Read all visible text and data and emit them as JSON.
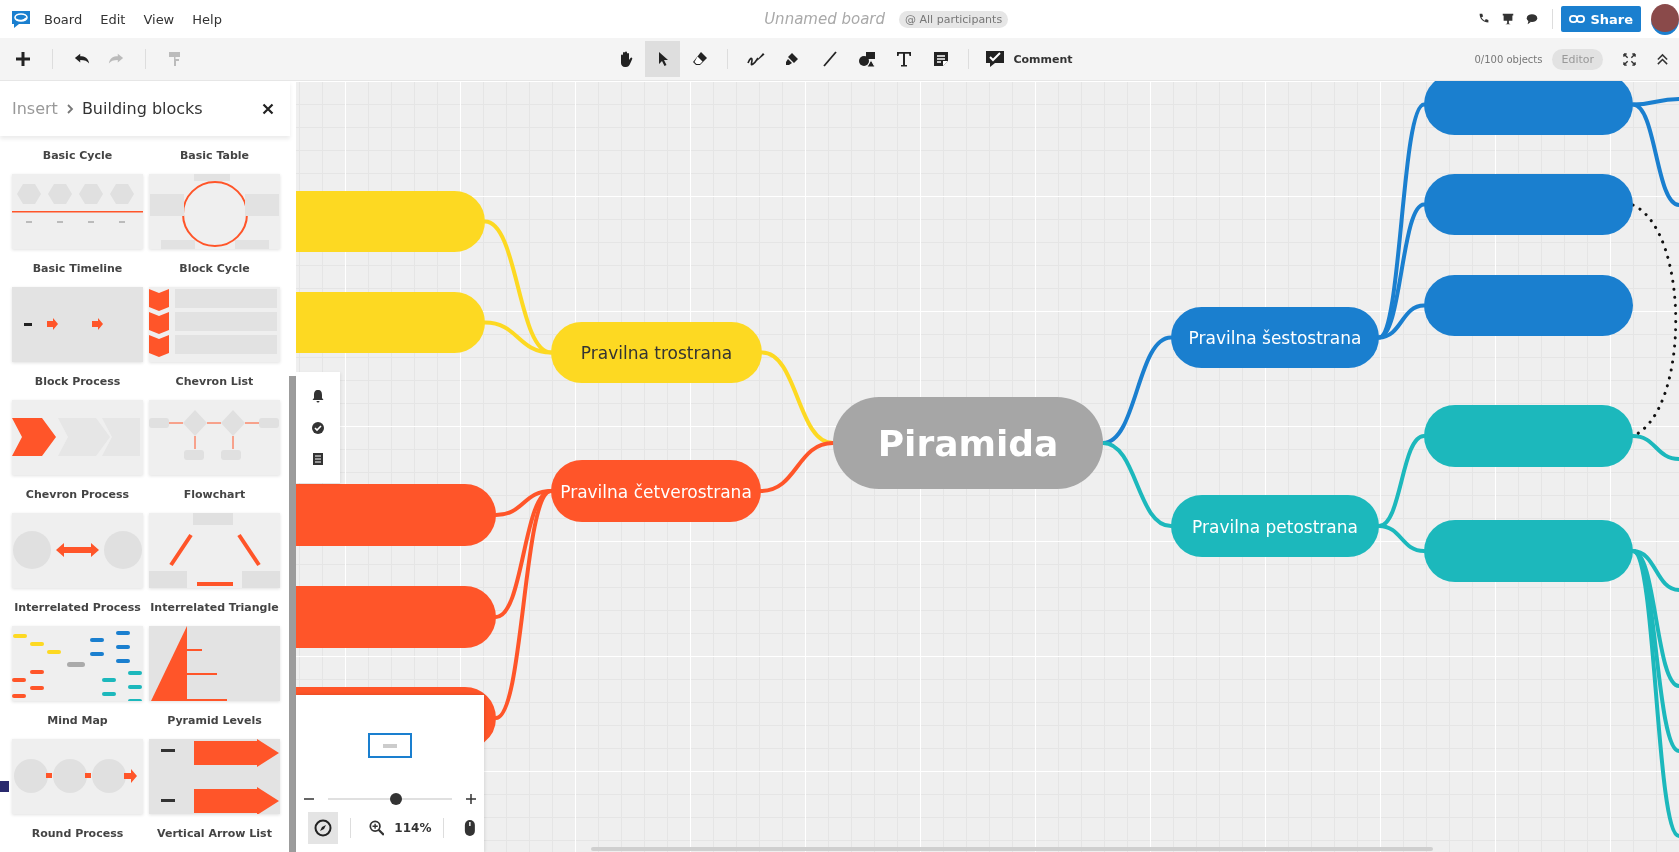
{
  "menu_bar": {
    "menus": [
      "Board",
      "Edit",
      "View",
      "Help"
    ],
    "board_title": "Unnamed board",
    "participants": "@ All participants",
    "share_button": "Share"
  },
  "toolbar": {
    "tools": [
      {
        "kind": "hand",
        "selected": false
      },
      {
        "kind": "pointer",
        "selected": true
      },
      {
        "kind": "eraser",
        "selected": false
      },
      {
        "kind": "pen",
        "selected": false
      },
      {
        "kind": "marker",
        "selected": false
      },
      {
        "kind": "line",
        "selected": false
      },
      {
        "kind": "shapes",
        "selected": false
      },
      {
        "kind": "text",
        "selected": false
      },
      {
        "kind": "note",
        "selected": false
      }
    ],
    "comment_button": "Comment",
    "object_count": "0/100 objects",
    "role": "Editor"
  },
  "insert_panel": {
    "breadcrumb_parent": "Insert",
    "breadcrumb_current": "Building blocks",
    "templates": [
      {
        "label": "Basic Cycle"
      },
      {
        "label": "Basic Table"
      },
      {
        "label": "Basic Timeline",
        "kind": "timeline"
      },
      {
        "label": "Block Cycle",
        "kind": "cycle"
      },
      {
        "label": "Block Process",
        "kind": "process"
      },
      {
        "label": "Chevron List",
        "kind": "chevrons"
      },
      {
        "label": "Chevron Process",
        "kind": "chevron"
      },
      {
        "label": "Flowchart",
        "kind": "flowchart"
      },
      {
        "label": "Interrelated Process",
        "kind": "interrelated"
      },
      {
        "label": "Interrelated Triangle",
        "kind": "triangle"
      },
      {
        "label": "Mind Map",
        "kind": "mindmap"
      },
      {
        "label": "Pyramid Levels",
        "kind": "pyramid"
      },
      {
        "label": "Round Process",
        "kind": "round"
      },
      {
        "label": "Vertical Arrow List",
        "kind": "arrows"
      }
    ]
  },
  "mind_map": {
    "center": {
      "label": "Piramida",
      "color": "#a6a6a6"
    },
    "branches": [
      {
        "label": "Pravilna trostrana",
        "color": "#fdd922"
      },
      {
        "label": "Pravilna četverostrana",
        "color": "#ff5529"
      },
      {
        "label": "Pravilna šestostrana",
        "color": "#1a7fcf"
      },
      {
        "label": "Pravilna petostrana",
        "color": "#1cb8bc"
      }
    ]
  },
  "zoom": {
    "level": 0.55,
    "reading": "114%"
  }
}
